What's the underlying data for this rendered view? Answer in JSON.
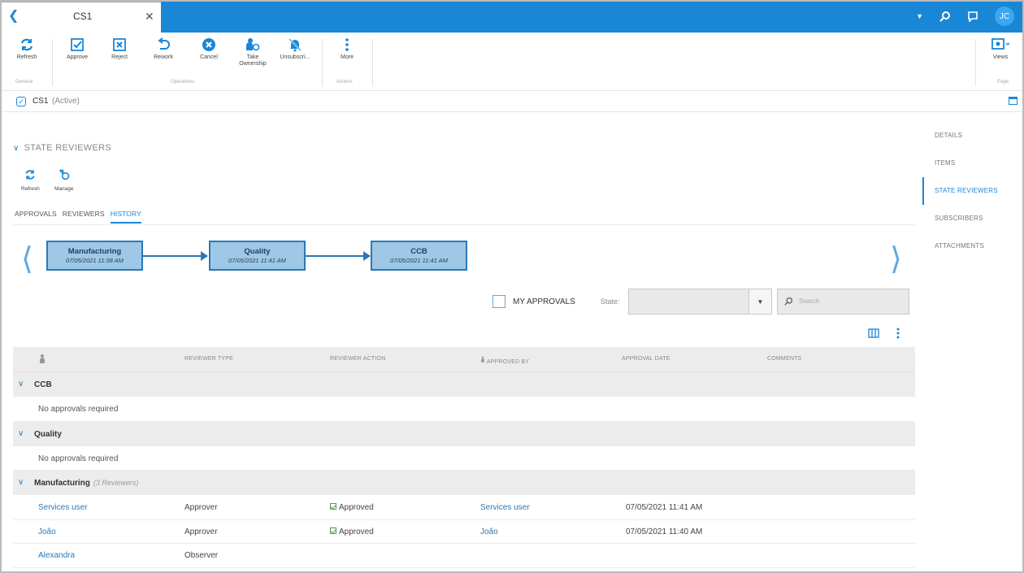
{
  "tab": {
    "title": "CS1"
  },
  "header": {
    "avatar_initials": "JC"
  },
  "ribbon": {
    "buttons": [
      {
        "label": "Refresh"
      },
      {
        "label": "Approve"
      },
      {
        "label": "Reject"
      },
      {
        "label": "Rework"
      },
      {
        "label": "Cancel"
      },
      {
        "label": "Take Ownership"
      },
      {
        "label": "Unsubscri..."
      },
      {
        "label": "More"
      },
      {
        "label": "Views"
      }
    ],
    "groups": [
      "General",
      "Operations",
      "Actions",
      "Page"
    ]
  },
  "breadcrumb": {
    "name": "CS1",
    "state": "(Active)"
  },
  "sidebar": {
    "items": [
      "DETAILS",
      "ITEMS",
      "STATE REVIEWERS",
      "SUBSCRIBERS",
      "ATTACHMENTS"
    ],
    "active": "STATE REVIEWERS"
  },
  "section": {
    "title": "STATE REVIEWERS",
    "tools": [
      "Refresh",
      "Manage"
    ],
    "tabs": [
      "APPROVALS",
      "REVIEWERS",
      "HISTORY"
    ],
    "active_tab": "HISTORY"
  },
  "flow": [
    {
      "name": "Manufacturing",
      "date": "07/05/2021 11:38 AM"
    },
    {
      "name": "Quality",
      "date": "07/05/2021 11:41 AM"
    },
    {
      "name": "CCB",
      "date": "07/05/2021 11:41 AM"
    }
  ],
  "filters": {
    "my_approvals": "MY APPROVALS",
    "state_label": "State:",
    "search_placeholder": "Search"
  },
  "table": {
    "columns": [
      "REVIEWER TYPE",
      "REVIEWER ACTION",
      "APPROVED BY",
      "APPROVAL DATE",
      "COMMENTS"
    ],
    "groups": [
      {
        "name": "CCB",
        "note": "No approvals required"
      },
      {
        "name": "Quality",
        "note": "No approvals required"
      },
      {
        "name": "Manufacturing",
        "count": "(3 Reviewers)",
        "rows": [
          {
            "reviewer": "Services user",
            "type": "Approver",
            "action": "Approved",
            "approved_by": "Services user",
            "date": "07/05/2021 11:41 AM"
          },
          {
            "reviewer": "João",
            "type": "Approver",
            "action": "Approved",
            "approved_by": "João",
            "date": "07/05/2021 11:40 AM"
          },
          {
            "reviewer": "Alexandra",
            "type": "Observer",
            "action": "",
            "approved_by": "",
            "date": ""
          }
        ]
      }
    ]
  },
  "colors": {
    "accent": "#1a86d6",
    "flow_box": "#9fc8e6",
    "approved": "#4aa04a"
  }
}
